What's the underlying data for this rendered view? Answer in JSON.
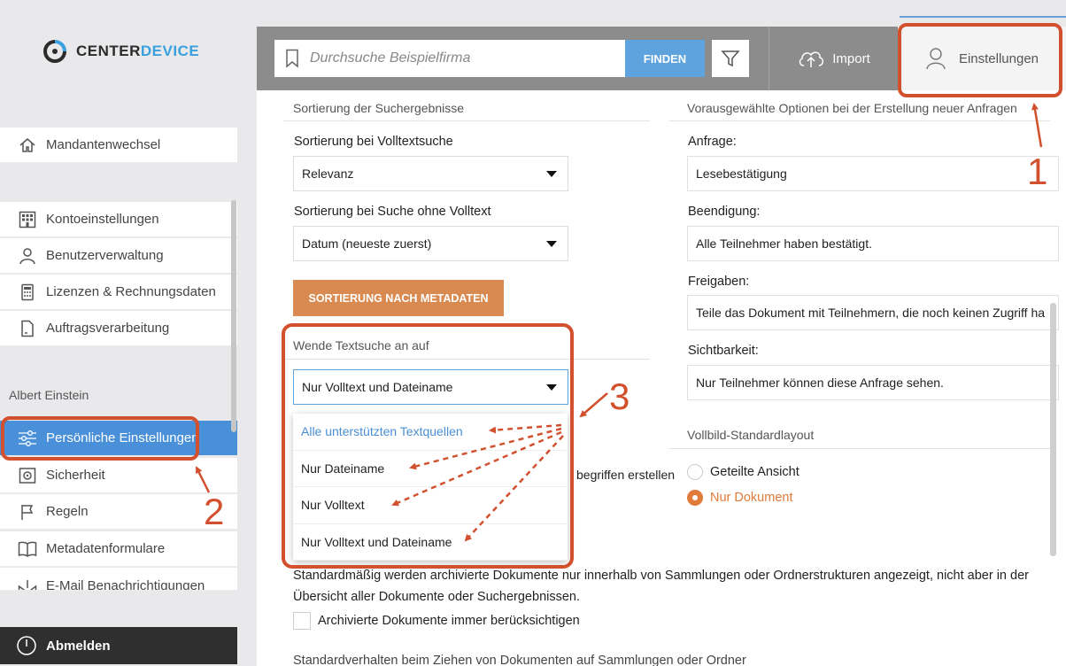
{
  "brand": {
    "name_part1": "CENTER",
    "name_part2": "DEVICE"
  },
  "sidebar": {
    "switch_label": "Mandantenwechsel",
    "account_items": [
      {
        "label": "Kontoeinstellungen",
        "icon": "building-grid-icon"
      },
      {
        "label": "Benutzerverwaltung",
        "icon": "user-icon"
      },
      {
        "label": "Lizenzen & Rechnungsdaten",
        "icon": "calculator-icon"
      },
      {
        "label": "Auftragsverarbeitung",
        "icon": "document-icon"
      }
    ],
    "user_name": "Albert Einstein",
    "user_items": [
      {
        "label": "Persönliche Einstellungen",
        "icon": "sliders-icon",
        "active": true
      },
      {
        "label": "Sicherheit",
        "icon": "safe-icon"
      },
      {
        "label": "Regeln",
        "icon": "flag-icon"
      },
      {
        "label": "Metadatenformulare",
        "icon": "book-icon"
      },
      {
        "label": "E-Mail Benachrichtigungen",
        "icon": "mail-download-icon"
      }
    ],
    "logout_label": "Abmelden"
  },
  "topbar": {
    "search_placeholder": "Durchsuche Beispielfirma",
    "find_label": "FINDEN",
    "import_label": "Import",
    "settings_label": "Einstellungen"
  },
  "left": {
    "section_title": "Sortierung der Suchergebnisse",
    "fulltext_label": "Sortierung bei Volltextsuche",
    "fulltext_value": "Relevanz",
    "nofulltext_label": "Sortierung bei Suche ohne Volltext",
    "nofulltext_value": "Datum (neueste zuerst)",
    "metadata_button": "SORTIERUNG NACH METADATEN",
    "textsearch_title": "Wende Textsuche an auf",
    "textsearch_value": "Nur Volltext und Dateiname",
    "textsearch_options": [
      "Alle unterstützten Textquellen",
      "Nur Dateiname",
      "Nur Volltext",
      "Nur Volltext und Dateiname"
    ],
    "partial_text": "begriffen erstellen"
  },
  "right": {
    "section_title": "Vorausgewählte Optionen bei der Erstellung neuer Anfragen",
    "request_label": "Anfrage:",
    "request_value": "Lesebestätigung",
    "end_label": "Beendigung:",
    "end_value": "Alle Teilnehmer haben bestätigt.",
    "share_label": "Freigaben:",
    "share_value": "Teile das Dokument mit Teilnehmern, die noch keinen Zugriff ha",
    "visibility_label": "Sichtbarkeit:",
    "visibility_value": "Nur Teilnehmer können diese Anfrage sehen.",
    "layout_title": "Vollbild-Standardlayout",
    "layout_options": [
      "Geteilte Ansicht",
      "Nur Dokument"
    ],
    "layout_selected": "Nur Dokument"
  },
  "archived": {
    "text": "Standardmäßig werden archivierte Dokumente nur innerhalb von Sammlungen oder Ordnerstrukturen angezeigt, nicht aber in der Übersicht aller Dokumente oder Suchergebnissen.",
    "checkbox_label": "Archivierte Dokumente immer berücksichtigen"
  },
  "drag_title": "Standardverhalten beim Ziehen von Dokumenten auf Sammlungen oder Ordner",
  "annotations": {
    "n1": "1",
    "n2": "2",
    "n3": "3"
  },
  "colors": {
    "accent_blue": "#4a90d9",
    "orange_button": "#d88a50",
    "annotation_red": "#d2502e",
    "radio_orange": "#e07b39"
  }
}
